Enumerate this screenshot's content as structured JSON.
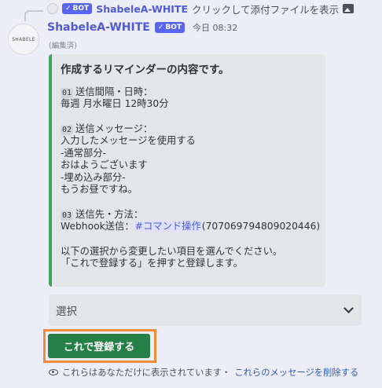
{
  "reply": {
    "author": "ShabeleA-WHITE",
    "bot_badge": "BOT",
    "text": "クリックして添付ファイルを表示"
  },
  "message": {
    "avatar_text": "SHABELE",
    "author": "ShabeleA-WHITE",
    "bot_badge": "BOT",
    "timestamp": "今日 08:32",
    "edited": "(編集済)"
  },
  "embed": {
    "color": "#3ba55c",
    "title": "作成するリマインダーの内容です。",
    "section1": {
      "num": "01",
      "label": "送信間隔・日時：",
      "value": "毎週 月水曜日 12時30分"
    },
    "section2": {
      "num": "02",
      "label": "送信メッセージ：",
      "lines": [
        "入力したメッセージを使用する",
        "-通常部分-",
        "おはようございます",
        "-埋め込み部分-",
        "もうお昼ですね。"
      ]
    },
    "section3": {
      "num": "03",
      "label": "送信先・方法：",
      "prefix": "Webhook送信：",
      "channel": "#コマンド操作",
      "channel_id": "(707069794809020446)"
    },
    "footer_lines": [
      "以下の選択から変更したい項目を選んでください。",
      "「これで登録する」を押すと登録します。"
    ]
  },
  "select": {
    "placeholder": "選択"
  },
  "button": {
    "label": "これで登録する",
    "color": "#248046"
  },
  "notice": {
    "text": "これらはあなただけに表示されています・",
    "link": "これらのメッセージを削除する"
  }
}
